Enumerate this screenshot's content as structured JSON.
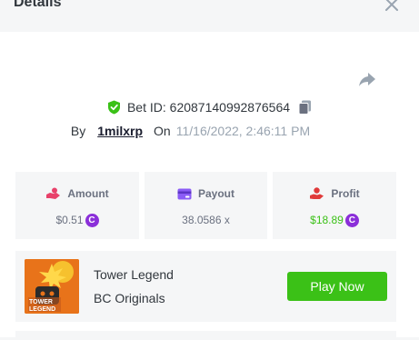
{
  "header": {
    "title": "Details"
  },
  "bet": {
    "id_label": "Bet ID: 62087140992876564",
    "by_label": "By",
    "username": "1milxrp",
    "on_label": "On",
    "datetime": "11/16/2022, 2:46:11 PM"
  },
  "stats": {
    "amount": {
      "label": "Amount",
      "value": "$0.51",
      "icon": "money-hand-icon"
    },
    "payout": {
      "label": "Payout",
      "value": "38.0586 x",
      "icon": "card-icon"
    },
    "profit": {
      "label": "Profit",
      "value": "$18.89",
      "icon": "hand-coin-icon"
    },
    "coin_symbol": "C"
  },
  "game": {
    "name": "Tower Legend",
    "provider": "BC Originals",
    "play_label": "Play Now",
    "thumb_text_1": "TOWER",
    "thumb_text_2": "LEGEND"
  },
  "colors": {
    "accent_green": "#3bc117",
    "coin_purple": "#8b2fd9",
    "amount_icon": "#e8416a",
    "payout_icon": "#8b5cf6",
    "profit_icon": "#e03a3a"
  }
}
